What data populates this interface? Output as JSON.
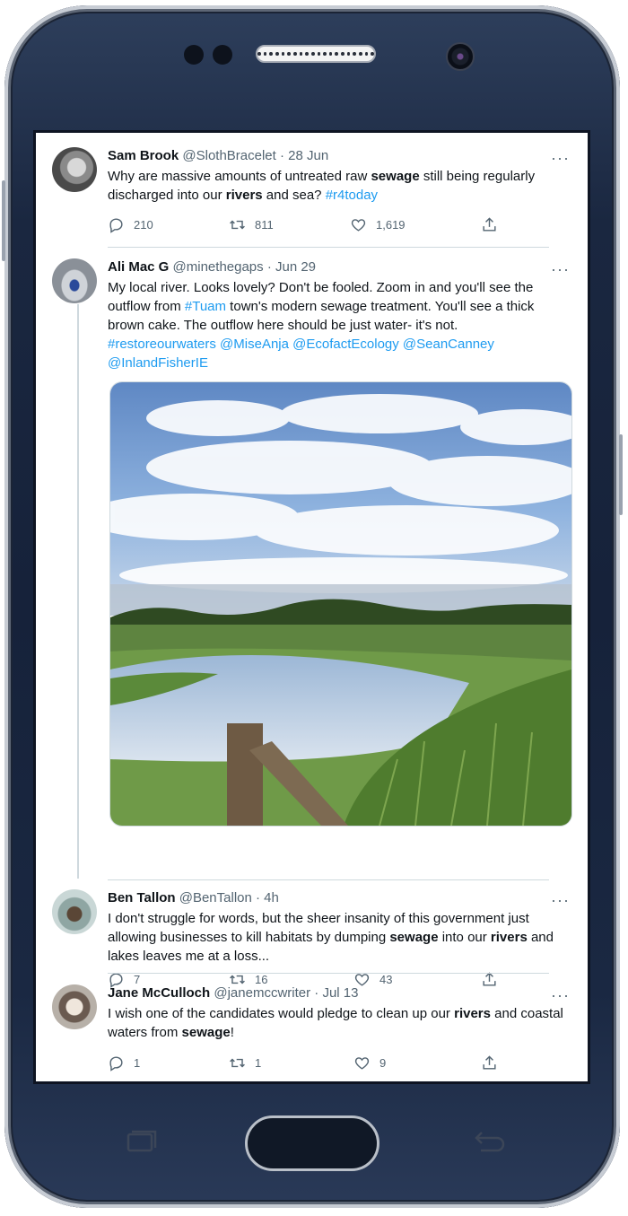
{
  "tweets": [
    {
      "name": "Sam Brook",
      "handle": "@SlothBracelet",
      "date": "· 28 Jun",
      "text_parts": [
        "Why are massive amounts of untreated raw ",
        "sewage",
        " still being regularly discharged into our ",
        "rivers",
        " and sea? ",
        "#r4today"
      ],
      "replies": "210",
      "retweets": "811",
      "likes": "1,619",
      "more": "···"
    },
    {
      "name": "Ali Mac G",
      "handle": "@minethegaps",
      "date": "· Jun 29",
      "text_parts": [
        "My local river. Looks lovely? Don't be fooled. Zoom in and you'll see the outflow from ",
        "#Tuam",
        " town's modern sewage treatment. You'll see a thick brown cake. The outflow here should be just water- it's not.",
        "#restoreourwaters @MiseAnja @EcofactEcology @SeanCanney @InlandFisherIE"
      ],
      "replies": "7",
      "retweets": "16",
      "likes": "43",
      "more": "···"
    },
    {
      "name": "Ben Tallon",
      "handle": "@BenTallon",
      "date": "· 4h",
      "text_parts": [
        "I don't struggle for words, but the sheer insanity of this government just allowing businesses to kill habitats by dumping ",
        "sewage",
        " into our ",
        "rivers",
        " and lakes leaves me at a loss..."
      ],
      "more": "···"
    },
    {
      "name": "Jane McCulloch",
      "handle": "@janemccwriter",
      "date": "· Jul 13",
      "text_parts": [
        "I wish one of the candidates would pledge to clean up our ",
        "rivers",
        " and coastal waters from ",
        "sewage",
        "!"
      ],
      "replies": "1",
      "retweets": "1",
      "likes": "9",
      "more": "···"
    }
  ],
  "colors": {
    "link": "#1d9bf0",
    "text": "#0f1419",
    "muted": "#536471",
    "phone_body": "#16223a"
  },
  "icons": [
    "reply-icon",
    "retweet-icon",
    "like-icon",
    "share-icon",
    "more-icon"
  ]
}
